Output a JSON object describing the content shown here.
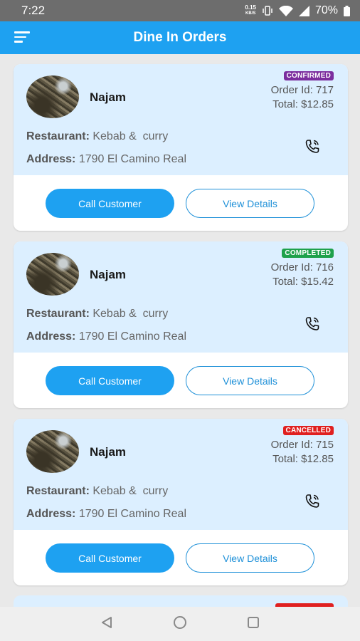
{
  "status_bar": {
    "time": "7:22",
    "speed_value": "0.15",
    "speed_unit": "KB/S",
    "battery": "70%"
  },
  "app_bar": {
    "title": "Dine In Orders"
  },
  "orders": [
    {
      "customer": "Najam",
      "status": "CONFIRMED",
      "status_color": "#7b2d9e",
      "order_id": "Order Id: 717",
      "total": "Total:   $12.85",
      "restaurant_label": "Restaurant:",
      "restaurant": "Kebab &  curry",
      "address_label": "Address:",
      "address": "1790 El Camino Real",
      "call_label": "Call Customer",
      "details_label": "View Details"
    },
    {
      "customer": "Najam",
      "status": "COMPLETED",
      "status_color": "#1ea14b",
      "order_id": "Order Id: 716",
      "total": "Total:   $15.42",
      "restaurant_label": "Restaurant:",
      "restaurant": "Kebab &  curry",
      "address_label": "Address:",
      "address": "1790 El Camino Real",
      "call_label": "Call Customer",
      "details_label": "View Details"
    },
    {
      "customer": "Najam",
      "status": "CANCELLED",
      "status_color": "#e02020",
      "order_id": "Order Id: 715",
      "total": "Total:   $12.85",
      "restaurant_label": "Restaurant:",
      "restaurant": "Kebab &  curry",
      "address_label": "Address:",
      "address": "1790 El Camino Real",
      "call_label": "Call Customer",
      "details_label": "View Details"
    }
  ],
  "icons": {
    "menu": "hamburger-menu-icon",
    "phone": "phone-call-icon",
    "back": "back-triangle-icon",
    "home": "home-circle-icon",
    "recents": "recents-square-icon"
  },
  "colors": {
    "accent": "#1ea1f1",
    "card_top": "#dcefff"
  }
}
